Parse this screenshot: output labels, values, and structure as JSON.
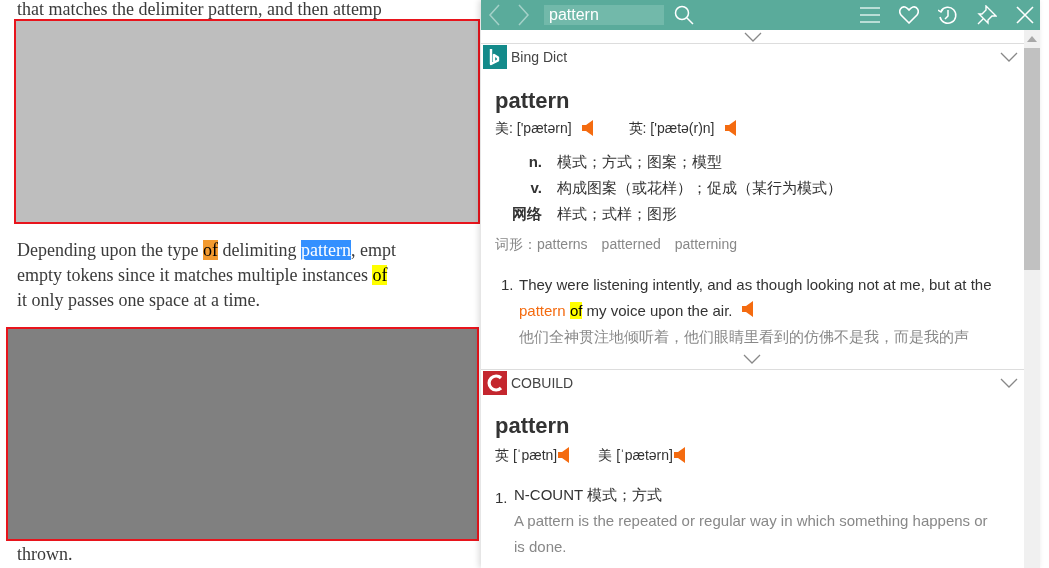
{
  "page": {
    "content": [
      {
        "kind": "text",
        "lines": [
          [
            {
              "text": "that matches the delimiter pattern, and then attemp"
            }
          ]
        ]
      },
      {
        "kind": "block",
        "color": "#bebebe"
      },
      {
        "kind": "text",
        "lines": [
          [
            {
              "text": "Depending upon the type "
            },
            {
              "text": "of",
              "kind": "hit"
            },
            {
              "text": " delimiting "
            },
            {
              "text": "pattern",
              "kind": "selection"
            },
            {
              "text": ", empt"
            }
          ],
          [
            {
              "text": "empty tokens since it matches multiple instances "
            },
            {
              "text": "of",
              "kind": "match"
            }
          ],
          [
            {
              "text": "it only passes one space at a time."
            }
          ]
        ]
      },
      {
        "kind": "block",
        "color": "#808080"
      },
      {
        "kind": "text",
        "lines": [
          [
            {
              "text": "thrown."
            }
          ]
        ]
      }
    ]
  },
  "popup": {
    "toolbar": {
      "back_enabled": false,
      "forward_enabled": false,
      "query": "pattern"
    },
    "sections": [
      {
        "kind": "bing",
        "source": "Bing Dict",
        "headword": "pattern",
        "pronunciations": [
          {
            "label": "美:",
            "ipa": "['pætərn]"
          },
          {
            "label": "英:",
            "ipa": "['pætə(r)n]"
          }
        ],
        "senses": [
          {
            "pos": "n.",
            "text": "模式；方式；图案；模型"
          },
          {
            "pos": "v.",
            "text": "构成图案（或花样）；促成（某行为模式）"
          },
          {
            "pos": "网络",
            "text": "样式；式样；图形"
          }
        ],
        "forms_label": "词形：",
        "forms": [
          "patterns",
          "patterned",
          "patterning"
        ],
        "examples": [
          {
            "number": "1.",
            "en": [
              {
                "text": "They were listening intently, and as though looking not at me, but at the "
              },
              {
                "text": "pattern ",
                "kind": "term"
              },
              {
                "text": "of",
                "kind": "match"
              },
              {
                "text": " my voice upon the air."
              }
            ],
            "zh": "他们全神贯注地倾听着，他们眼睛里看到的仿佛不是我，而是我的声"
          }
        ]
      },
      {
        "kind": "cobuild",
        "source": "COBUILD",
        "headword": "pattern",
        "pronunciations": [
          {
            "label": "英",
            "ipa": "[ˈpætn]"
          },
          {
            "label": "美",
            "ipa": "[ˈpætərn]"
          }
        ],
        "definitions": [
          {
            "number": "1.",
            "label": "N-COUNT 模式；方式",
            "text": "A pattern is the repeated or regular way in which something happens or is done."
          }
        ]
      }
    ]
  }
}
